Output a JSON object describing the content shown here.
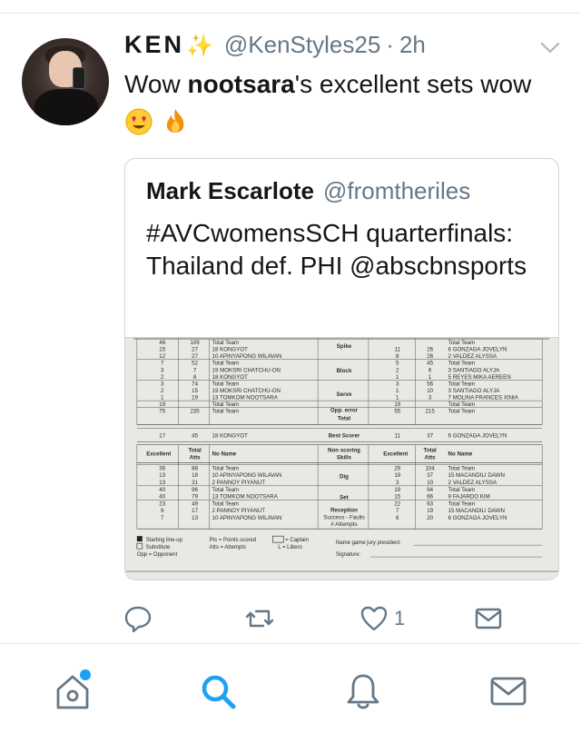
{
  "tweet": {
    "display_name": "KEN",
    "name_emoji": "✨",
    "handle": "@KenStyles25",
    "separator": "·",
    "time": "2h",
    "text_before": "Wow ",
    "text_bold": "nootsara",
    "text_after": "'s excellent sets wow",
    "emoji_icons": [
      "heart-eyes-emoji-icon",
      "fire-emoji-icon"
    ]
  },
  "quoted": {
    "name": "Mark Escarlote",
    "handle": "@fromtheriles",
    "text": "#AVCwomensSCH quarterfinals: Thailand def. PHI @abscbnsports",
    "photo": {
      "top_table": {
        "left_rows": [
          [
            "46",
            "109",
            "Total Team"
          ],
          [
            "15",
            "27",
            "18 KONGYOT"
          ],
          [
            "12",
            "27",
            "10 APINYAPONG WILAVAN"
          ],
          [
            "7",
            "52",
            "Total Team"
          ],
          [
            "3",
            "7",
            "19 MOKSRI CHATCHU-ON"
          ],
          [
            "2",
            "8",
            "18 KONGYOT"
          ],
          [
            "3",
            "74",
            "Total Team"
          ],
          [
            "2",
            "15",
            "19 MOKSRI CHATCHU-ON"
          ],
          [
            "1",
            "19",
            "13 TOMKOM NOOTSARA"
          ],
          [
            "19",
            "",
            "Total Team"
          ],
          [
            "75",
            "235",
            "Total Team"
          ]
        ],
        "skills": [
          "Spike",
          "Block",
          "Serve",
          "Opp. error",
          "Total"
        ],
        "right_rows": [
          [
            "",
            "",
            "Total Team"
          ],
          [
            "11",
            "26",
            "6 GONZAGA JOVELYN"
          ],
          [
            "8",
            "26",
            "2 VALDEZ ALYSSA"
          ],
          [
            "5",
            "45",
            "Total Team"
          ],
          [
            "2",
            "6",
            "3 SANTIAGO ALYJA"
          ],
          [
            "1",
            "1",
            "5 REYES MIKA AEREEN"
          ],
          [
            "3",
            "56",
            "Total Team"
          ],
          [
            "1",
            "10",
            "3 SANTIAGO ALYJA"
          ],
          [
            "1",
            "3",
            "7 MOLINA FRANCES XINIA"
          ],
          [
            "19",
            "",
            "Total Team"
          ],
          [
            "55",
            "215",
            "Total Team"
          ]
        ],
        "best_scorer_label": "Best Scorer",
        "best_left": [
          "17",
          "45",
          "18 KONGYOT"
        ],
        "best_right": [
          "11",
          "37",
          "6 GONZAGA JOVELYN"
        ]
      },
      "bottom_table": {
        "headers_left": [
          "Excellent",
          "Total Atts",
          "No Name"
        ],
        "headers_mid": "Non scoring Skills",
        "headers_right": [
          "Excellent",
          "Total Atts",
          "No Name"
        ],
        "left_rows": [
          [
            "36",
            "88",
            "Total Team"
          ],
          [
            "13",
            "18",
            "10 APINYAPONG WILAVAN"
          ],
          [
            "13",
            "31",
            "2 PANNOY PIYANUT"
          ],
          [
            "40",
            "96",
            "Total Team"
          ],
          [
            "40",
            "79",
            "13 TOMKOM NOOTSARA"
          ],
          [
            "23",
            "49",
            "Total Team"
          ],
          [
            "9",
            "17",
            "2 PANNOY PIYANUT"
          ],
          [
            "7",
            "13",
            "10 APINYAPONG WILAVAN"
          ]
        ],
        "skills": [
          "Dig",
          "Set",
          "Reception",
          "Success - Faults",
          "# Attempts"
        ],
        "right_rows": [
          [
            "29",
            "104",
            "Total Team"
          ],
          [
            "19",
            "37",
            "15 MACANDILI DAWN"
          ],
          [
            "3",
            "10",
            "2 VALDEZ ALYSSA"
          ],
          [
            "19",
            "94",
            "Total Team"
          ],
          [
            "15",
            "66",
            "9 FAJARDO KIM"
          ],
          [
            "22",
            "63",
            "Total Team"
          ],
          [
            "7",
            "19",
            "15 MACANDILI DAWN"
          ],
          [
            "6",
            "20",
            "6 GONZAGA JOVELYN"
          ]
        ]
      },
      "legend": {
        "starting": "Starting line-up",
        "substitute": "Substitute",
        "opp": "Opp = Opponent",
        "pts": "Pts = Points scored",
        "atts": "Atts = Attempts",
        "captain": "= Captain",
        "libero": "L = Libero",
        "jury": "Name game jury president:",
        "signature": "Signature:"
      }
    }
  },
  "actions": {
    "reply_icon": "reply-icon",
    "retweet_icon": "retweet-icon",
    "like_icon": "heart-icon",
    "like_count": "1",
    "dm_icon": "mail-icon"
  },
  "tabbar": {
    "items": [
      "home-icon",
      "search-icon",
      "notifications-icon",
      "messages-icon"
    ],
    "active": "search-icon",
    "accent": "#1da1f2"
  },
  "colors": {
    "text": "#14171a",
    "secondary": "#657786",
    "border": "#ccd6dd",
    "accent": "#1da1f2",
    "photo_bg": "#e9e9e7"
  }
}
